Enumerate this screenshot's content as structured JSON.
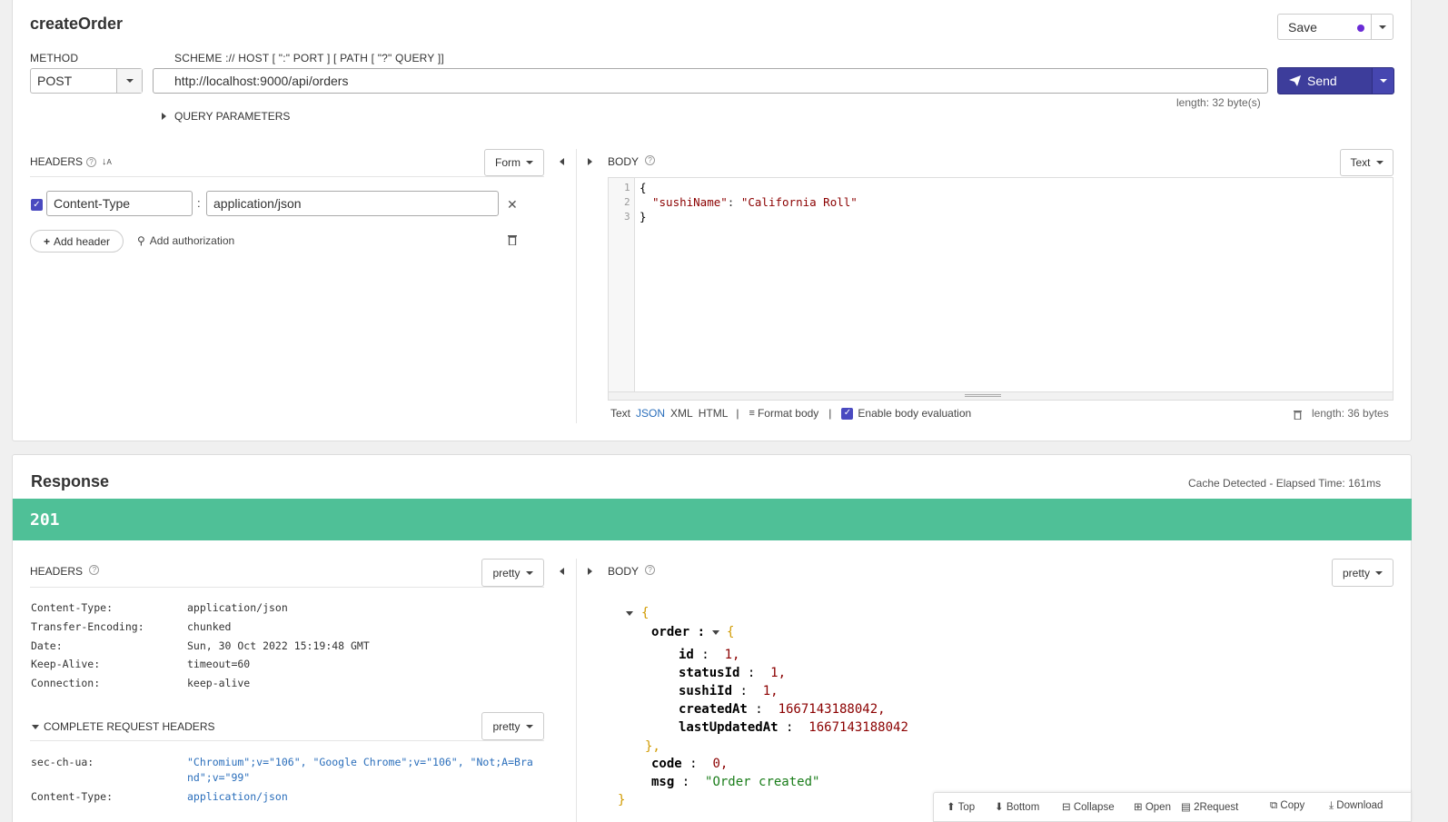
{
  "request": {
    "title": "createOrder",
    "save_label": "Save",
    "method_label": "METHOD",
    "method_value": "POST",
    "url_label": "SCHEME :// HOST [ \":\" PORT ] [ PATH [ \"?\" QUERY ]]",
    "url_value": "http://localhost:9000/api/orders",
    "send_label": "Send",
    "url_length": "length: 32 byte(s)",
    "query_params_label": "QUERY PARAMETERS",
    "headers_label": "HEADERS",
    "headers_mode": "Form",
    "header_name": "Content-Type",
    "header_value": "application/json",
    "add_header_label": "Add header",
    "add_authorization_label": "Add authorization",
    "body_label": "BODY",
    "body_mode": "Text",
    "body_lines": [
      "{",
      "  \"sushiName\": \"California Roll\"",
      "}"
    ],
    "body_key": "\"sushiName\"",
    "body_val": "\"California Roll\"",
    "line_numbers": [
      "1",
      "2",
      "3"
    ],
    "format_text": "Text",
    "format_json": "JSON",
    "format_xml": "XML",
    "format_html": "HTML",
    "format_body_label": "Format body",
    "enable_eval_label": "Enable body evaluation",
    "body_length": "length: 36 bytes"
  },
  "response": {
    "title": "Response",
    "elapsed": "Cache Detected - Elapsed Time: 161ms",
    "status": "201",
    "status_color": "#4fc097",
    "headers_label": "HEADERS",
    "headers_mode": "pretty",
    "headers": [
      {
        "k": "Content-Type:",
        "v": "application/json"
      },
      {
        "k": "Transfer-Encoding:",
        "v": "chunked"
      },
      {
        "k": "Date:",
        "v": "Sun, 30 Oct 2022 15:19:48 GMT"
      },
      {
        "k": "Keep-Alive:",
        "v": "timeout=60"
      },
      {
        "k": "Connection:",
        "v": "keep-alive"
      }
    ],
    "complete_request_headers_label": "COMPLETE REQUEST HEADERS",
    "complete_mode": "pretty",
    "req_headers": [
      {
        "k": "sec-ch-ua:",
        "v1": "\"Chromium\";v=\"106\", \"Google Chrome\";v=\"106\", \"Not;A=Bra",
        "v2": "nd\";v=\"99\""
      },
      {
        "k": "Content-Type:",
        "v1": "application/json",
        "v2": ""
      }
    ],
    "body_label": "BODY",
    "body_mode": "pretty",
    "json": {
      "order_key": "order",
      "id_key": "id",
      "id_val": "1,",
      "statusId_key": "statusId",
      "statusId_val": "1,",
      "sushiId_key": "sushiId",
      "sushiId_val": "1,",
      "createdAt_key": "createdAt",
      "createdAt_val": "1667143188042,",
      "lastUpdatedAt_key": "lastUpdatedAt",
      "lastUpdatedAt_val": "1667143188042",
      "code_key": "code",
      "code_val": "0,",
      "msg_key": "msg",
      "msg_val": "\"Order created\""
    },
    "toolbar": [
      "Top",
      "Bottom",
      "Collapse",
      "Open",
      "2Request",
      "Copy",
      "Download"
    ]
  },
  "colors": {
    "accent": "#3d3d9b",
    "status_green": "#4fc097",
    "link_blue": "#2a6ebb"
  }
}
